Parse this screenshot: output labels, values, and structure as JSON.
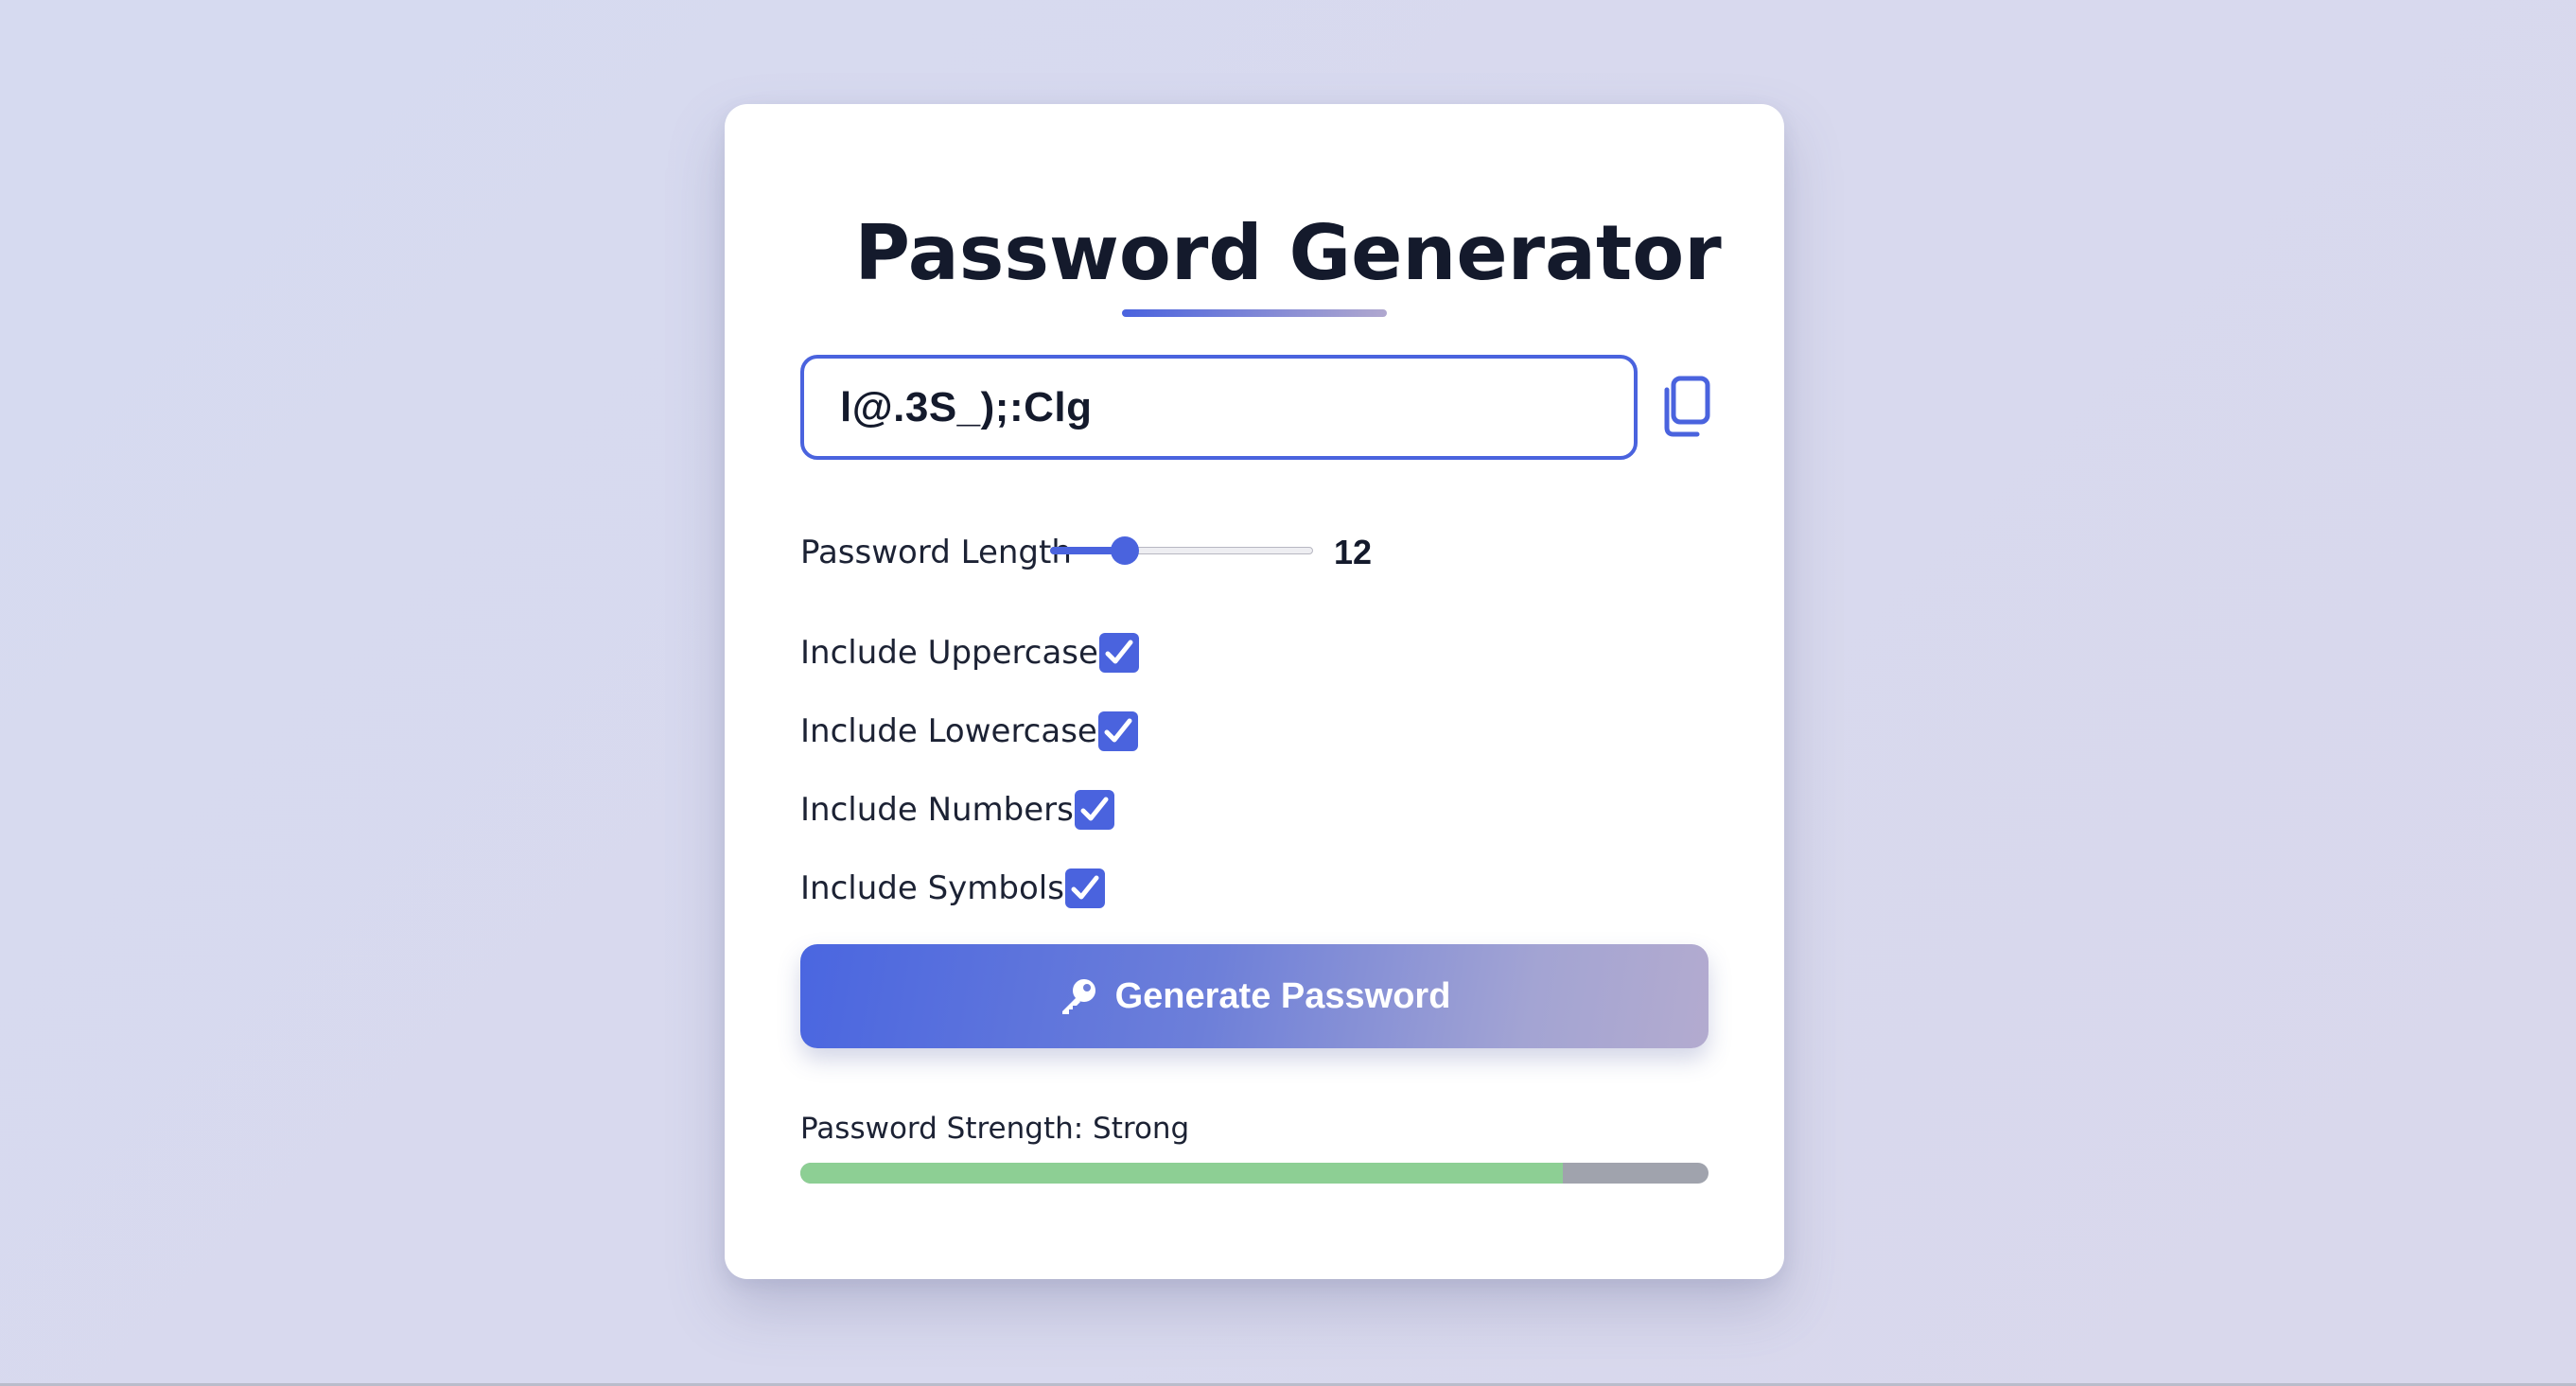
{
  "app": {
    "title": "Password Generator"
  },
  "password": {
    "value": "l@.3S_);:Clg"
  },
  "length": {
    "label": "Password Length",
    "value": "12",
    "min": 4,
    "max": 32,
    "current": 12
  },
  "options": [
    {
      "label": "Include Uppercase",
      "checked": true
    },
    {
      "label": "Include Lowercase",
      "checked": true
    },
    {
      "label": "Include Numbers",
      "checked": true
    },
    {
      "label": "Include Symbols",
      "checked": true
    }
  ],
  "generate": {
    "label": "Generate Password",
    "icon": "key-icon"
  },
  "strength": {
    "label": "Password Strength: Strong",
    "fraction": 0.84
  },
  "colors": {
    "accent": "#4a63de",
    "strength_fill": "#8dcf94",
    "strength_track": "#a0a3ad",
    "title": "#141a2c"
  },
  "icons": {
    "copy": "copy-icon",
    "check": "checkmark-icon"
  }
}
